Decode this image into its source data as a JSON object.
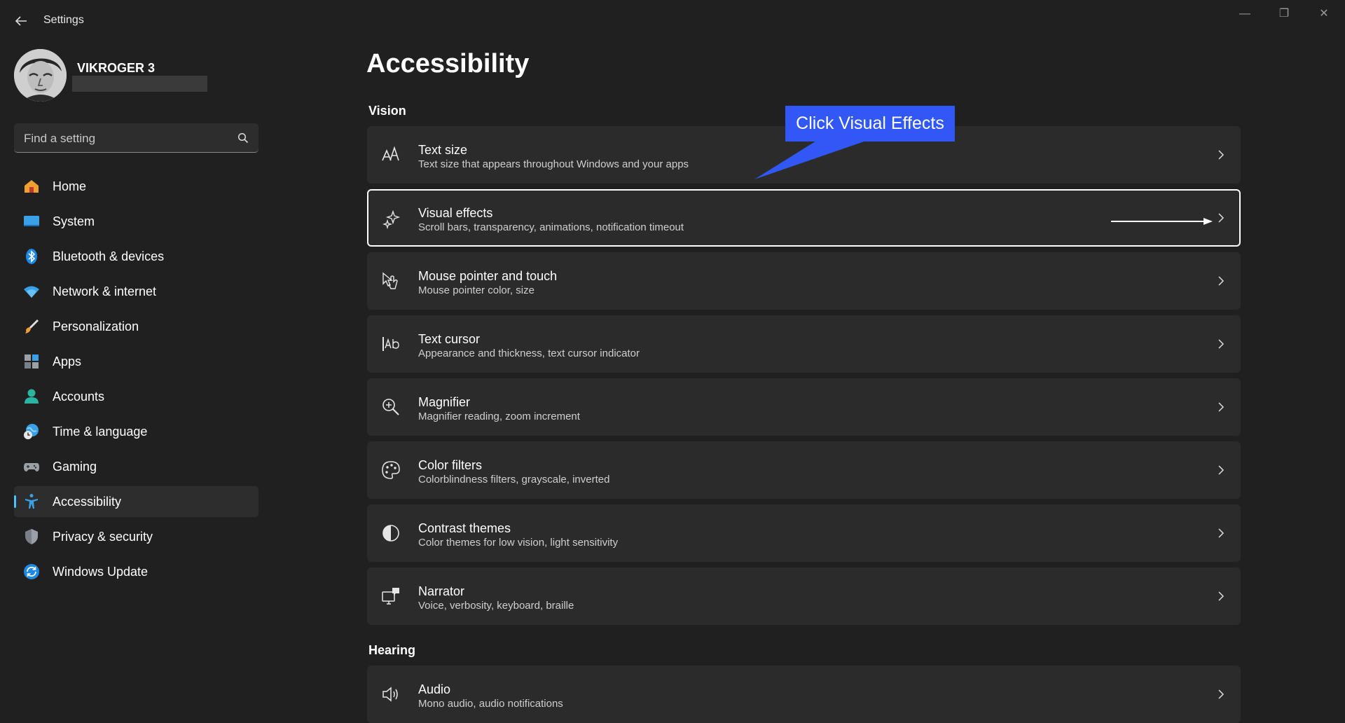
{
  "window": {
    "title": "Settings",
    "controls": {
      "minimize": "—",
      "restore": "❐",
      "close": "✕"
    }
  },
  "profile": {
    "name": "VIKROGER 3"
  },
  "search": {
    "placeholder": "Find a setting"
  },
  "nav": {
    "items": [
      {
        "label": "Home",
        "icon": "home-icon"
      },
      {
        "label": "System",
        "icon": "system-icon"
      },
      {
        "label": "Bluetooth & devices",
        "icon": "bluetooth-icon"
      },
      {
        "label": "Network & internet",
        "icon": "wifi-icon"
      },
      {
        "label": "Personalization",
        "icon": "brush-icon"
      },
      {
        "label": "Apps",
        "icon": "apps-icon"
      },
      {
        "label": "Accounts",
        "icon": "accounts-icon"
      },
      {
        "label": "Time & language",
        "icon": "globe-clock-icon"
      },
      {
        "label": "Gaming",
        "icon": "gamepad-icon"
      },
      {
        "label": "Accessibility",
        "icon": "accessibility-icon",
        "active": true
      },
      {
        "label": "Privacy & security",
        "icon": "shield-icon"
      },
      {
        "label": "Windows Update",
        "icon": "update-icon"
      }
    ]
  },
  "main": {
    "title": "Accessibility",
    "sections": {
      "vision": "Vision",
      "hearing": "Hearing"
    },
    "cards": [
      {
        "title": "Text size",
        "subtitle": "Text size that appears throughout Windows and your apps",
        "icon": "text-size-icon"
      },
      {
        "title": "Visual effects",
        "subtitle": "Scroll bars, transparency, animations, notification timeout",
        "icon": "sparkle-icon",
        "selected": true
      },
      {
        "title": "Mouse pointer and touch",
        "subtitle": "Mouse pointer color, size",
        "icon": "mouse-pointer-icon"
      },
      {
        "title": "Text cursor",
        "subtitle": "Appearance and thickness, text cursor indicator",
        "icon": "text-cursor-icon"
      },
      {
        "title": "Magnifier",
        "subtitle": "Magnifier reading, zoom increment",
        "icon": "magnifier-icon"
      },
      {
        "title": "Color filters",
        "subtitle": "Colorblindness filters, grayscale, inverted",
        "icon": "palette-icon"
      },
      {
        "title": "Contrast themes",
        "subtitle": "Color themes for low vision, light sensitivity",
        "icon": "contrast-icon"
      },
      {
        "title": "Narrator",
        "subtitle": "Voice, verbosity, keyboard, braille",
        "icon": "narrator-icon"
      },
      {
        "title": "Audio",
        "subtitle": "Mono audio, audio notifications",
        "icon": "speaker-icon"
      }
    ]
  },
  "annotation": {
    "callout": "Click Visual Effects"
  },
  "colors": {
    "background": "#202020",
    "card": "#2b2b2b",
    "accent": "#4cc2ff",
    "callout": "#3158f5"
  }
}
